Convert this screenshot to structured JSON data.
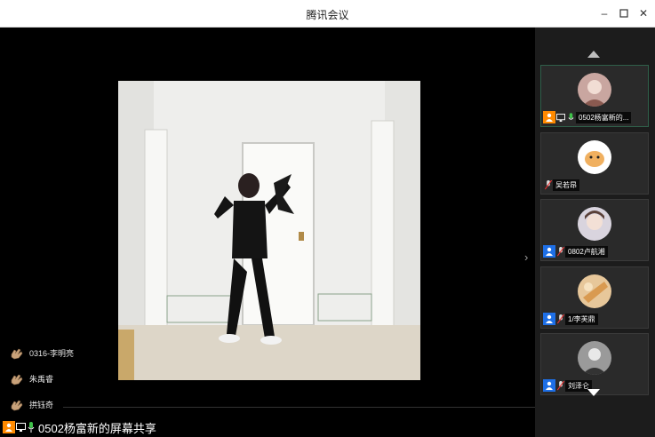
{
  "window": {
    "title": "腾讯会议"
  },
  "participants": [
    {
      "name": "0502杨富新的...",
      "role": "host",
      "mic": "on",
      "sharing": true,
      "active": true
    },
    {
      "name": "吴若昂",
      "role": "none",
      "mic": "muted",
      "sharing": false,
      "active": false
    },
    {
      "name": "0802卢航湘",
      "role": "member",
      "mic": "muted",
      "sharing": false,
      "active": false
    },
    {
      "name": "1/李芙鼎",
      "role": "member",
      "mic": "muted",
      "sharing": false,
      "active": false
    },
    {
      "name": "刘泽仑",
      "role": "member",
      "mic": "muted",
      "sharing": false,
      "active": false
    }
  ],
  "raised_hands": [
    {
      "name": "0316-李明亮"
    },
    {
      "name": "朱禹睿"
    },
    {
      "name": "拱钰奇"
    }
  ],
  "share_status": {
    "label": "0502杨富新的屏幕共享"
  },
  "icons": {
    "scroll_up": "triangle-up-icon",
    "scroll_down": "triangle-down-icon",
    "expand": "chevron-right-icon",
    "hand": "raised-hand-icon"
  },
  "colors": {
    "host": "#ff8a00",
    "member": "#1e6fe6",
    "mic_on": "#3fc24a"
  }
}
